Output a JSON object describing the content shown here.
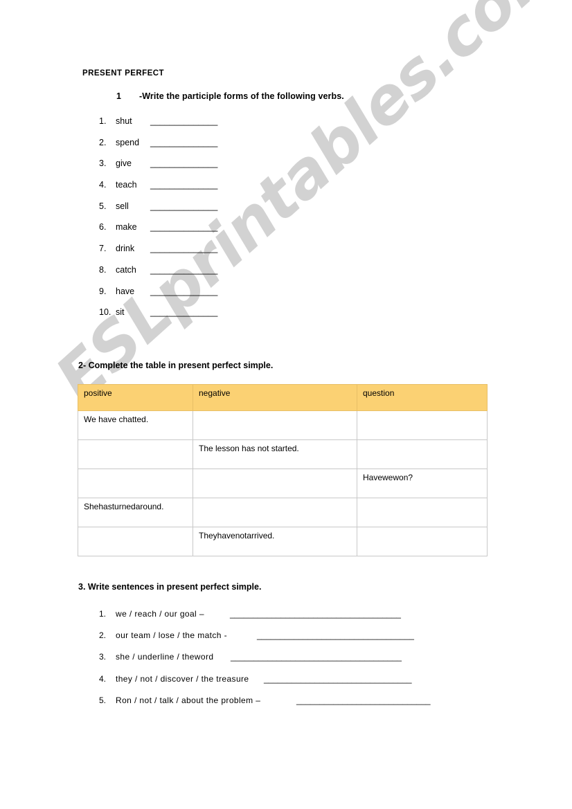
{
  "document": {
    "title": "PRESENT PERFECT",
    "watermark": "ESLprintables.com",
    "accent_color": "#fbd173",
    "table_border_color": "#c8c8c8"
  },
  "section1": {
    "number": "1",
    "instruction": "-Write the participle forms of the following verbs.",
    "blank": "______________",
    "items": [
      {
        "num": "1.",
        "verb": "shut"
      },
      {
        "num": "2.",
        "verb": "spend"
      },
      {
        "num": "3.",
        "verb": "give"
      },
      {
        "num": "4.",
        "verb": "teach"
      },
      {
        "num": "5.",
        "verb": "sell"
      },
      {
        "num": "6.",
        "verb": "make"
      },
      {
        "num": "7.",
        "verb": "drink"
      },
      {
        "num": "8.",
        "verb": "catch"
      },
      {
        "num": "9.",
        "verb": "have"
      },
      {
        "num": "10.",
        "verb": "sit"
      }
    ]
  },
  "section2": {
    "instruction": "2-  Complete the table in present perfect simple.",
    "columns": [
      "positive",
      "negative",
      "question"
    ],
    "rows": [
      [
        "We have chatted.",
        "",
        ""
      ],
      [
        "",
        "The lesson has not started.",
        ""
      ],
      [
        "",
        "",
        "Havewewon?"
      ],
      [
        "Shehasturnedaround.",
        "",
        ""
      ],
      [
        "",
        "Theyhavenotarrived.",
        ""
      ]
    ]
  },
  "section3": {
    "instruction": "3. Write sentences in present perfect simple.",
    "items": [
      {
        "num": "1.",
        "prompt": "we / reach / our goal –",
        "blank": "_____________________________________"
      },
      {
        "num": "2.",
        "prompt": "our team / lose / the match -",
        "blank": "__________________________________"
      },
      {
        "num": "3.",
        "prompt": "she / underline / theword",
        "blank": "_____________________________________"
      },
      {
        "num": "4.",
        "prompt": "they / not / discover / the treasure",
        "blank": "________________________________"
      },
      {
        "num": "5.",
        "prompt": "Ron / not / talk / about the problem –",
        "blank": "_____________________________"
      }
    ]
  }
}
